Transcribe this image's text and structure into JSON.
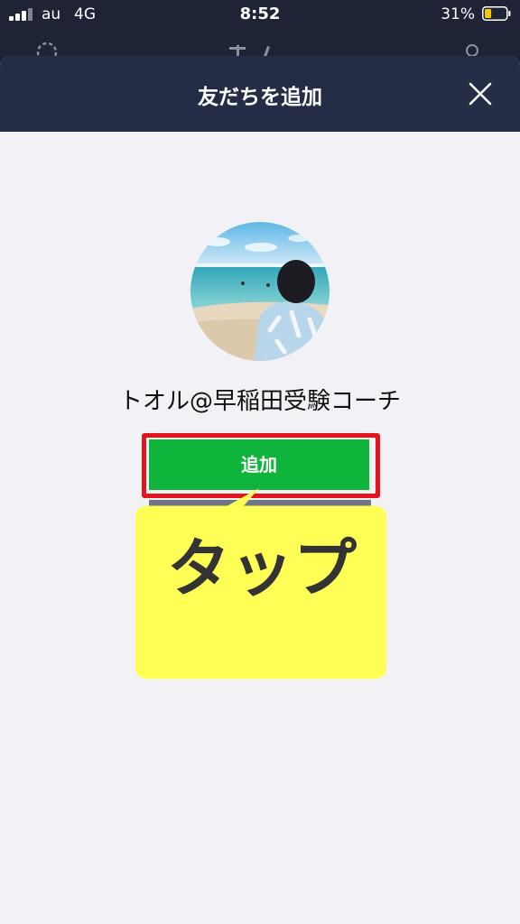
{
  "status_bar": {
    "carrier": "au",
    "network": "4G",
    "time": "8:52",
    "battery_percent": "31%",
    "battery_level": 0.31,
    "battery_color": "#f7c900"
  },
  "sheet": {
    "title": "友だちを追加",
    "close_icon": "close-icon"
  },
  "profile": {
    "name": "トオル@早稲田受験コーチ",
    "avatar": "beach-photo-avatar"
  },
  "actions": {
    "add_label": "追加",
    "add_color": "#0fb43a",
    "highlight_color": "#e3141c"
  },
  "annotation": {
    "tap_label": "タップ",
    "callout_color": "#ffff55"
  }
}
